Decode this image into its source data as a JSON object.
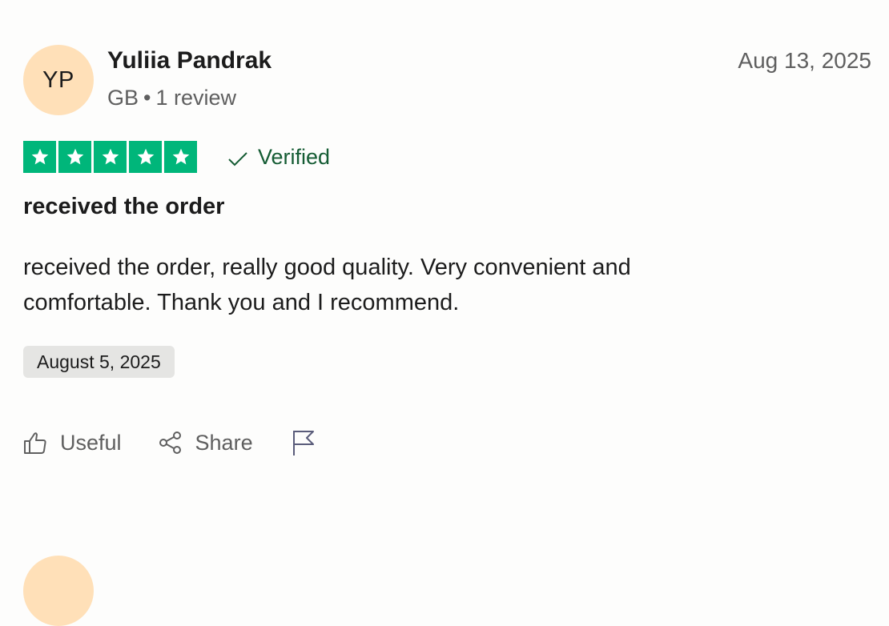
{
  "review": {
    "avatar_initials": "YP",
    "avatar_color": "#ffe0b8",
    "reviewer_name": "Yuliia Pandrak",
    "country": "GB",
    "separator": "•",
    "review_count": "1 review",
    "posted_date": "Aug 13, 2025",
    "rating": 5,
    "rating_max": 5,
    "star_color": "#00b67a",
    "verified_label": "Verified",
    "title": "received the order",
    "body": "received the order, really good quality. Very convenient and comfortable. Thank you and I recommend.",
    "experience_date": "August 5, 2025",
    "actions": {
      "useful_label": "Useful",
      "share_label": "Share",
      "flag_icon": "flag-icon"
    }
  },
  "next_review": {
    "avatar_color": "#ffe0b8"
  }
}
